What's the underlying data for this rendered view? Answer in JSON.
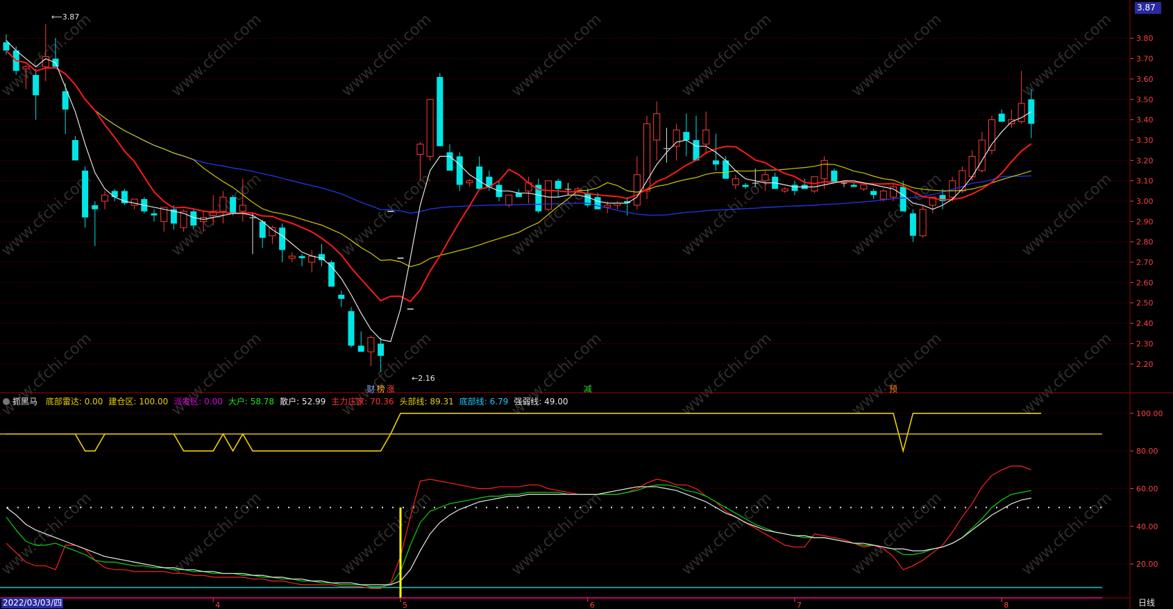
{
  "colors": {
    "bg": "#000000",
    "grid": "#7a0000",
    "axis": "#a00000",
    "up": "#ff3b3b",
    "down": "#00e6e6",
    "ma_white": "#e6e6e6",
    "ma_red": "#ff1a1a",
    "ma_yellow": "#cccc00",
    "ma_blue": "#2233dd",
    "axis_text": "#ff4040",
    "price_box": "#2a2aa0",
    "radar": "#f0d000",
    "ind_red": "#ff2020",
    "ind_green": "#10d010",
    "ind_white": "#e8e8e8",
    "cyan_line": "#00e0e0",
    "magenta_line": "#e000e0",
    "vline": "#ffff00",
    "watermark": "#555555"
  },
  "price_box": "3.87",
  "annotations": {
    "high": "3.87",
    "low": "2.16"
  },
  "event_markers": [
    {
      "text": "财",
      "color": "#7da4ff",
      "x": 37
    },
    {
      "text": "榜",
      "color": "#ffb040",
      "x": 38
    },
    {
      "text": "涨",
      "color": "#ff4040",
      "x": 39
    },
    {
      "text": "减",
      "color": "#30d030",
      "x": 59
    },
    {
      "text": "预",
      "color": "#ff8020",
      "x": 90
    }
  ],
  "legend": {
    "title": "抓黑马",
    "items": [
      {
        "label": "底部雷达: 0.00",
        "color": "#e8d000"
      },
      {
        "label": "建仓区: 100.00",
        "color": "#e8d000"
      },
      {
        "label": "派发区: 0.00",
        "color": "#e000e0"
      },
      {
        "label": "大户: 58.78",
        "color": "#20e020"
      },
      {
        "label": "散户: 52.99",
        "color": "#e8e8e8"
      },
      {
        "label": "主力庄家: 70.36",
        "color": "#ff3030"
      },
      {
        "label": "头部线: 89.31",
        "color": "#e8d000"
      },
      {
        "label": "底部线: 6.79",
        "color": "#20c8ff"
      },
      {
        "label": "强弱线: 49.00",
        "color": "#e8e8e8"
      }
    ]
  },
  "date_label": "2022/03/03/四",
  "period_label": "日线",
  "watermark_text": "www.cfchi.com",
  "chart_data": [
    {
      "type": "candlestick",
      "x_tick_labels": [
        {
          "x": 21,
          "label": "4"
        },
        {
          "x": 40,
          "label": "5"
        },
        {
          "x": 59,
          "label": "6"
        },
        {
          "x": 80,
          "label": "7"
        },
        {
          "x": 101,
          "label": "8"
        }
      ],
      "y_ticks": [
        2.2,
        2.3,
        2.4,
        2.5,
        2.6,
        2.7,
        2.8,
        2.9,
        3.0,
        3.1,
        3.2,
        3.3,
        3.4,
        3.5,
        3.6,
        3.7,
        3.8
      ],
      "ylim": [
        2.08,
        3.92
      ],
      "ohlc": [
        [
          3.78,
          3.82,
          3.72,
          3.74
        ],
        [
          3.74,
          3.76,
          3.62,
          3.64
        ],
        [
          3.65,
          3.67,
          3.55,
          3.66
        ],
        [
          3.62,
          3.65,
          3.4,
          3.52
        ],
        [
          3.66,
          3.87,
          3.59,
          3.71
        ],
        [
          3.7,
          3.8,
          3.66,
          3.66
        ],
        [
          3.54,
          3.58,
          3.33,
          3.45
        ],
        [
          3.3,
          3.32,
          3.2,
          3.2
        ],
        [
          3.15,
          3.17,
          2.87,
          2.92
        ],
        [
          2.98,
          3.0,
          2.78,
          2.96
        ],
        [
          3.0,
          3.05,
          2.96,
          3.03
        ],
        [
          3.05,
          3.06,
          3.0,
          3.02
        ],
        [
          3.05,
          3.06,
          2.98,
          2.99
        ],
        [
          2.98,
          3.01,
          2.96,
          3.01
        ],
        [
          3.01,
          3.02,
          2.94,
          2.95
        ],
        [
          2.94,
          2.96,
          2.9,
          2.93
        ],
        [
          2.9,
          2.97,
          2.85,
          2.97
        ],
        [
          2.96,
          2.98,
          2.86,
          2.89
        ],
        [
          2.87,
          2.96,
          2.85,
          2.95
        ],
        [
          2.95,
          2.96,
          2.86,
          2.88
        ],
        [
          2.9,
          2.95,
          2.85,
          2.92
        ],
        [
          2.93,
          3.03,
          2.88,
          2.95
        ],
        [
          2.95,
          3.05,
          2.89,
          3.02
        ],
        [
          3.02,
          3.03,
          2.93,
          2.94
        ],
        [
          2.95,
          3.11,
          2.9,
          2.98
        ],
        [
          2.92,
          2.94,
          2.74,
          2.92
        ],
        [
          2.9,
          2.91,
          2.77,
          2.82
        ],
        [
          2.83,
          2.88,
          2.79,
          2.87
        ],
        [
          2.87,
          2.89,
          2.7,
          2.76
        ],
        [
          2.72,
          2.75,
          2.7,
          2.73
        ],
        [
          2.73,
          2.74,
          2.68,
          2.72
        ],
        [
          2.7,
          2.76,
          2.65,
          2.73
        ],
        [
          2.74,
          2.79,
          2.68,
          2.71
        ],
        [
          2.7,
          2.71,
          2.58,
          2.58
        ],
        [
          2.54,
          2.56,
          2.48,
          2.52
        ],
        [
          2.46,
          2.48,
          2.28,
          2.29
        ],
        [
          2.29,
          2.36,
          2.27,
          2.26
        ],
        [
          2.26,
          2.34,
          2.19,
          2.33
        ],
        [
          2.3,
          2.33,
          2.16,
          2.24
        ],
        [
          2.95,
          2.95,
          2.95,
          2.95
        ],
        [
          2.72,
          2.72,
          2.72,
          2.72
        ],
        [
          2.47,
          2.47,
          2.47,
          2.47
        ],
        [
          3.23,
          3.29,
          3.1,
          3.28
        ],
        [
          3.22,
          3.5,
          3.2,
          3.5
        ],
        [
          3.61,
          3.63,
          3.27,
          3.27
        ],
        [
          3.24,
          3.28,
          3.15,
          3.15
        ],
        [
          3.22,
          3.24,
          3.05,
          3.08
        ],
        [
          3.09,
          3.11,
          3.07,
          3.1
        ],
        [
          3.17,
          3.22,
          3.06,
          3.06
        ],
        [
          3.12,
          3.15,
          3.05,
          3.07
        ],
        [
          3.08,
          3.1,
          3.0,
          3.02
        ],
        [
          2.98,
          3.03,
          2.97,
          3.03
        ],
        [
          3.04,
          3.06,
          3.02,
          3.02
        ],
        [
          3.05,
          3.12,
          2.99,
          3.09
        ],
        [
          3.08,
          3.11,
          2.94,
          2.95
        ],
        [
          2.96,
          3.1,
          2.95,
          3.1
        ],
        [
          3.1,
          3.11,
          3.02,
          3.06
        ],
        [
          3.06,
          3.09,
          3.03,
          3.06
        ],
        [
          3.05,
          3.07,
          3.04,
          3.06
        ],
        [
          3.04,
          3.06,
          2.97,
          2.98
        ],
        [
          3.02,
          3.04,
          2.96,
          2.96
        ],
        [
          2.97,
          3.0,
          2.94,
          2.98
        ],
        [
          2.98,
          3.0,
          2.96,
          2.99
        ],
        [
          3.0,
          3.02,
          2.93,
          2.99
        ],
        [
          2.98,
          3.22,
          2.96,
          3.13
        ],
        [
          3.05,
          3.42,
          3.01,
          3.38
        ],
        [
          3.3,
          3.49,
          3.2,
          3.43
        ],
        [
          3.26,
          3.36,
          3.19,
          3.26
        ],
        [
          3.27,
          3.38,
          3.2,
          3.35
        ],
        [
          3.34,
          3.43,
          3.22,
          3.3
        ],
        [
          3.3,
          3.42,
          3.2,
          3.2
        ],
        [
          3.28,
          3.44,
          3.23,
          3.35
        ],
        [
          3.2,
          3.33,
          3.15,
          3.18
        ],
        [
          3.2,
          3.22,
          3.11,
          3.11
        ],
        [
          3.08,
          3.13,
          3.06,
          3.11
        ],
        [
          3.08,
          3.09,
          3.06,
          3.07
        ],
        [
          3.09,
          3.16,
          3.07,
          3.09
        ],
        [
          3.1,
          3.15,
          3.05,
          3.13
        ],
        [
          3.12,
          3.14,
          3.06,
          3.06
        ],
        [
          3.05,
          3.07,
          3.04,
          3.06
        ],
        [
          3.08,
          3.1,
          3.03,
          3.05
        ],
        [
          3.08,
          3.11,
          3.06,
          3.06
        ],
        [
          3.05,
          3.12,
          3.04,
          3.12
        ],
        [
          3.11,
          3.22,
          3.06,
          3.2
        ],
        [
          3.15,
          3.16,
          3.09,
          3.09
        ],
        [
          3.09,
          3.1,
          3.07,
          3.09
        ],
        [
          3.08,
          3.09,
          3.07,
          3.07
        ],
        [
          3.06,
          3.08,
          3.05,
          3.08
        ],
        [
          3.05,
          3.06,
          3.01,
          3.03
        ],
        [
          3.01,
          3.06,
          3.0,
          3.05
        ],
        [
          3.02,
          3.09,
          3.0,
          3.07
        ],
        [
          3.07,
          3.1,
          2.95,
          2.95
        ],
        [
          2.94,
          2.96,
          2.8,
          2.83
        ],
        [
          2.83,
          2.98,
          2.82,
          2.96
        ],
        [
          2.98,
          3.02,
          2.94,
          3.02
        ],
        [
          3.03,
          3.06,
          2.96,
          3.0
        ],
        [
          3.02,
          3.12,
          3.0,
          3.1
        ],
        [
          3.05,
          3.17,
          3.04,
          3.15
        ],
        [
          3.12,
          3.25,
          3.1,
          3.22
        ],
        [
          3.15,
          3.34,
          3.14,
          3.3
        ],
        [
          3.25,
          3.42,
          3.23,
          3.4
        ],
        [
          3.43,
          3.45,
          3.39,
          3.39
        ],
        [
          3.38,
          3.45,
          3.36,
          3.4
        ],
        [
          3.39,
          3.64,
          3.38,
          3.48
        ],
        [
          3.5,
          3.55,
          3.31,
          3.38
        ]
      ],
      "ma_white": [
        3.79,
        3.74,
        3.7,
        3.66,
        3.7,
        3.68,
        3.56,
        3.44,
        3.28,
        3.14,
        3.06,
        3.02,
        3.0,
        2.99,
        2.98,
        2.97,
        2.96,
        2.95,
        2.94,
        2.92,
        2.91,
        2.92,
        2.93,
        2.94,
        2.94,
        2.93,
        2.9,
        2.86,
        2.83,
        2.79,
        2.75,
        2.73,
        2.72,
        2.68,
        2.62,
        2.54,
        2.45,
        2.37,
        2.32,
        2.31,
        2.47,
        2.72,
        2.98,
        3.15,
        3.22,
        3.22,
        3.18,
        3.13,
        3.1,
        3.07,
        3.05,
        3.05,
        3.04,
        3.04,
        3.03,
        3.02,
        3.02,
        3.03,
        3.03,
        3.02,
        3.0,
        2.99,
        2.99,
        2.99,
        3.02,
        3.1,
        3.18,
        3.24,
        3.29,
        3.3,
        3.27,
        3.27,
        3.24,
        3.2,
        3.15,
        3.11,
        3.1,
        3.09,
        3.09,
        3.08,
        3.07,
        3.07,
        3.07,
        3.08,
        3.09,
        3.1,
        3.1,
        3.09,
        3.08,
        3.07,
        3.06,
        3.03,
        2.99,
        2.98,
        2.96,
        2.98,
        3.01,
        3.06,
        3.12,
        3.2,
        3.28,
        3.34,
        3.39,
        3.41,
        3.44
      ]
    },
    {
      "type": "line",
      "y_ticks": [
        20,
        40,
        60,
        80,
        100
      ],
      "ylim": [
        2,
        104
      ],
      "radar_yellow": [
        89,
        89,
        89,
        89,
        89,
        89,
        89,
        89,
        80,
        80,
        89,
        89,
        89,
        89,
        89,
        89,
        89,
        89,
        80,
        80,
        80,
        80,
        89,
        80,
        89,
        80,
        80,
        80,
        80,
        80,
        80,
        80,
        80,
        80,
        80,
        80,
        80,
        80,
        80,
        89,
        100,
        100,
        100,
        100,
        100,
        100,
        100,
        100,
        100,
        100,
        100,
        100,
        100,
        100,
        100,
        100,
        100,
        100,
        100,
        100,
        100,
        100,
        100,
        100,
        100,
        100,
        100,
        100,
        100,
        100,
        100,
        100,
        100,
        100,
        100,
        100,
        100,
        100,
        100,
        100,
        100,
        100,
        100,
        100,
        100,
        100,
        100,
        100,
        100,
        100,
        100,
        80,
        100,
        100,
        100,
        100,
        100,
        100,
        100,
        100,
        100,
        100,
        100,
        100,
        100,
        100
      ],
      "series": [
        {
          "name": "主力庄家",
          "color": "#ff2020",
          "values": [
            31,
            26,
            21,
            19,
            19,
            17,
            30,
            30,
            28,
            22,
            18,
            17,
            17,
            16,
            16,
            16,
            16,
            15,
            15,
            14,
            14,
            13,
            13,
            13,
            13,
            12,
            12,
            11,
            11,
            10,
            9,
            9,
            9,
            9,
            8,
            8,
            8,
            7,
            7,
            10,
            24,
            45,
            64,
            65,
            64,
            63,
            62,
            61,
            60,
            60,
            61,
            61,
            61,
            62,
            62,
            60,
            59,
            58,
            57,
            57,
            57,
            57,
            57,
            58,
            60,
            63,
            65,
            64,
            62,
            62,
            60,
            56,
            53,
            48,
            45,
            42,
            39,
            36,
            33,
            30,
            29,
            29,
            36,
            35,
            34,
            33,
            31,
            29,
            30,
            28,
            24,
            17,
            19,
            22,
            26,
            30,
            37,
            45,
            52,
            61,
            67,
            70,
            72,
            72,
            70
          ]
        },
        {
          "name": "大户",
          "color": "#10d010",
          "values": [
            45,
            38,
            32,
            30,
            30,
            31,
            29,
            27,
            25,
            22,
            21,
            21,
            20,
            19,
            19,
            18,
            18,
            17,
            17,
            16,
            16,
            15,
            15,
            15,
            14,
            14,
            13,
            13,
            12,
            12,
            11,
            11,
            10,
            10,
            9,
            9,
            9,
            8,
            8,
            9,
            16,
            30,
            42,
            48,
            50,
            52,
            53,
            54,
            55,
            56,
            56,
            57,
            57,
            58,
            58,
            58,
            58,
            57,
            57,
            57,
            57,
            57,
            57,
            58,
            59,
            61,
            62,
            62,
            61,
            59,
            58,
            56,
            53,
            50,
            47,
            44,
            41,
            39,
            37,
            36,
            35,
            34,
            34,
            34,
            33,
            32,
            31,
            30,
            30,
            29,
            28,
            25,
            25,
            26,
            28,
            29,
            31,
            34,
            39,
            44,
            50,
            54,
            57,
            58,
            59
          ]
        },
        {
          "name": "散户",
          "color": "#e8e8e8",
          "values": [
            50,
            46,
            41,
            38,
            36,
            34,
            32,
            30,
            28,
            26,
            24,
            23,
            22,
            21,
            20,
            19,
            18,
            18,
            17,
            17,
            16,
            16,
            15,
            15,
            15,
            14,
            14,
            13,
            13,
            12,
            12,
            11,
            11,
            10,
            10,
            10,
            9,
            9,
            9,
            9,
            11,
            17,
            27,
            36,
            42,
            46,
            49,
            51,
            53,
            54,
            55,
            56,
            56,
            57,
            57,
            57,
            57,
            57,
            57,
            57,
            57,
            58,
            59,
            60,
            61,
            61,
            61,
            60,
            59,
            57,
            55,
            53,
            50,
            47,
            45,
            42,
            40,
            38,
            37,
            36,
            35,
            35,
            34,
            34,
            33,
            32,
            31,
            31,
            30,
            29,
            28,
            28,
            27,
            27,
            28,
            29,
            31,
            34,
            38,
            42,
            46,
            49,
            52,
            54,
            55
          ]
        }
      ],
      "top_line": 89,
      "dotted_line": 50,
      "bottom_line": 7.5,
      "magenta_line": 2,
      "signal_bar": 40
    }
  ]
}
